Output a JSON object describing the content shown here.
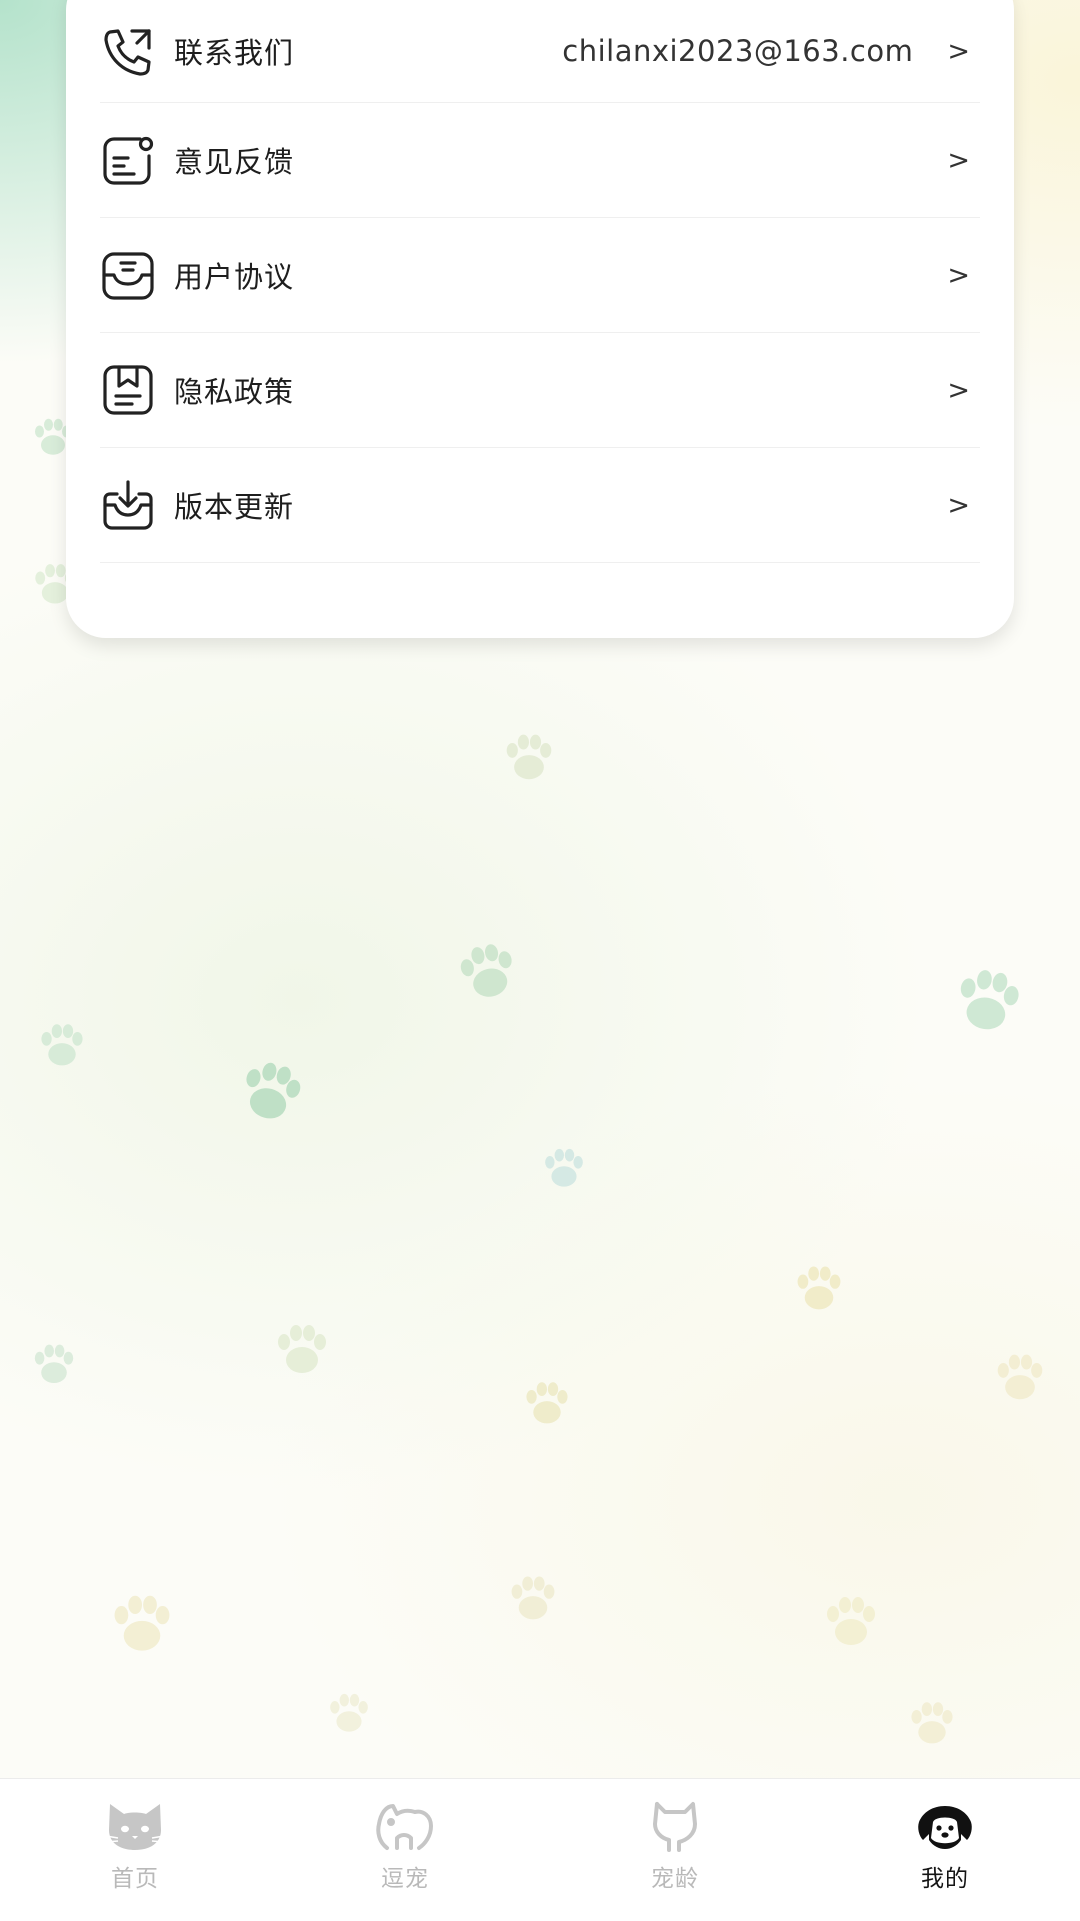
{
  "menu": {
    "items": [
      {
        "id": "contact",
        "label": "联系我们",
        "value": "chilanxi2023@163.com",
        "icon": "phone-icon",
        "chevron": ">"
      },
      {
        "id": "feedback",
        "label": "意见反馈",
        "value": "",
        "icon": "feedback-icon",
        "chevron": ">"
      },
      {
        "id": "agreement",
        "label": "用户协议",
        "value": "",
        "icon": "agreement-icon",
        "chevron": ">"
      },
      {
        "id": "privacy",
        "label": "隐私政策",
        "value": "",
        "icon": "privacy-icon",
        "chevron": ">"
      },
      {
        "id": "update",
        "label": "版本更新",
        "value": "",
        "icon": "update-icon",
        "chevron": ">"
      }
    ]
  },
  "tabbar": {
    "tabs": [
      {
        "label": "首页",
        "icon": "cat-face-icon",
        "active": false
      },
      {
        "label": "逗宠",
        "icon": "pet-play-icon",
        "active": false
      },
      {
        "label": "宠龄",
        "icon": "cat-silhouette-icon",
        "active": false
      },
      {
        "label": "我的",
        "icon": "dog-face-icon",
        "active": true
      }
    ]
  },
  "colors": {
    "inactive_tab": "#b9b9b9",
    "active_tab": "#151515",
    "card_bg": "#ffffff",
    "paw_green": "#b9dcc2",
    "paw_yellow": "#efeac4"
  }
}
